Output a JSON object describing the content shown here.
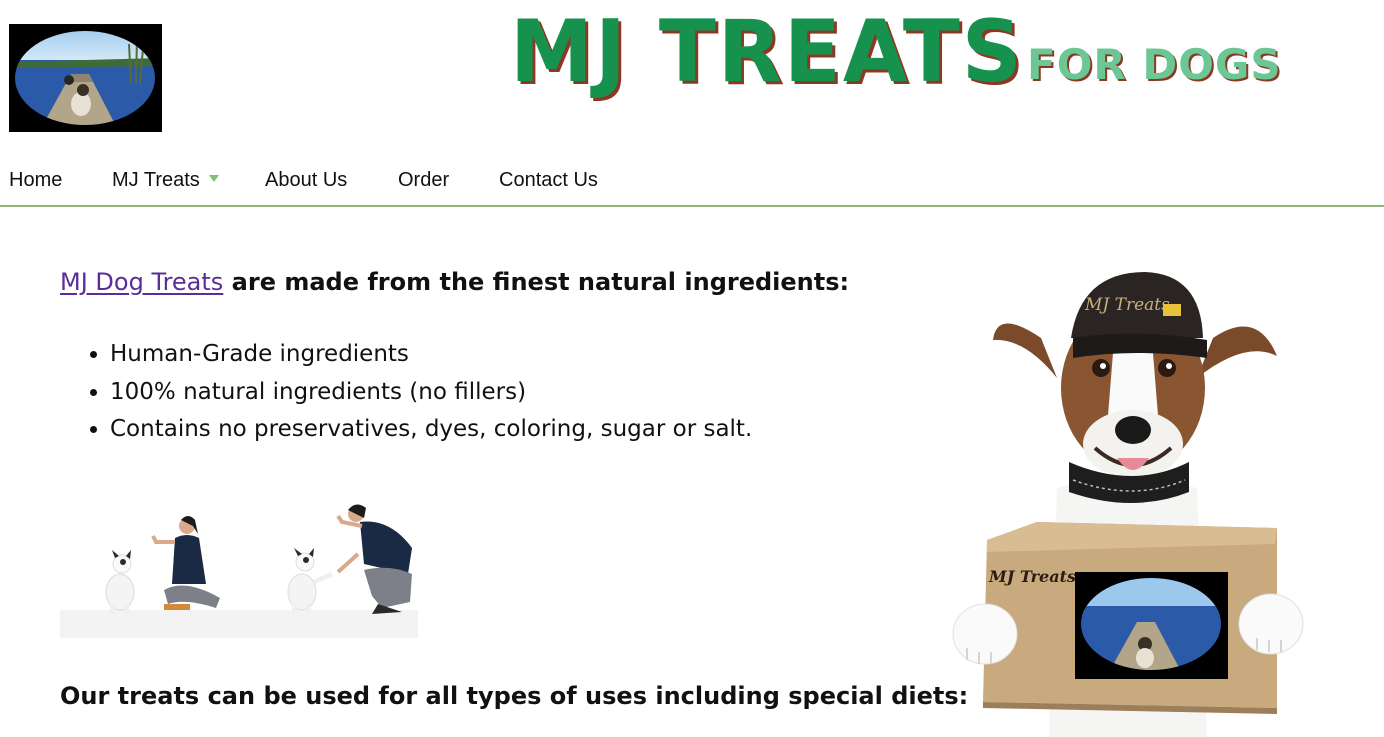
{
  "header": {
    "logo_alt": "MJ Treats logo - dog on dock",
    "brand_main": "MJ TREATS",
    "brand_sub": "FOR DOGS"
  },
  "nav": {
    "items": [
      {
        "label": "Home",
        "has_dropdown": false
      },
      {
        "label": "MJ Treats",
        "has_dropdown": true
      },
      {
        "label": "About Us",
        "has_dropdown": false
      },
      {
        "label": "Order",
        "has_dropdown": false
      },
      {
        "label": "Contact Us",
        "has_dropdown": false
      }
    ]
  },
  "main": {
    "intro_link": "MJ Dog Treats",
    "intro_rest": " are made from the finest natural ingredients:",
    "bullets": [
      "Human-Grade ingredients",
      "100% natural ingredients (no fillers)",
      "Contains no preservatives, dyes, coloring, sugar or salt."
    ],
    "uses_heading": "Our treats can be used for all types of uses including special diets:",
    "dog_cap_text": "MJ Treats",
    "dog_box_text": "MJ Treats"
  },
  "colors": {
    "brand_green": "#17914e",
    "brand_light_green": "#6cc795",
    "brand_shadow": "#8a3a24",
    "nav_border": "#8fb47a",
    "link_purple": "#5a2e96"
  }
}
